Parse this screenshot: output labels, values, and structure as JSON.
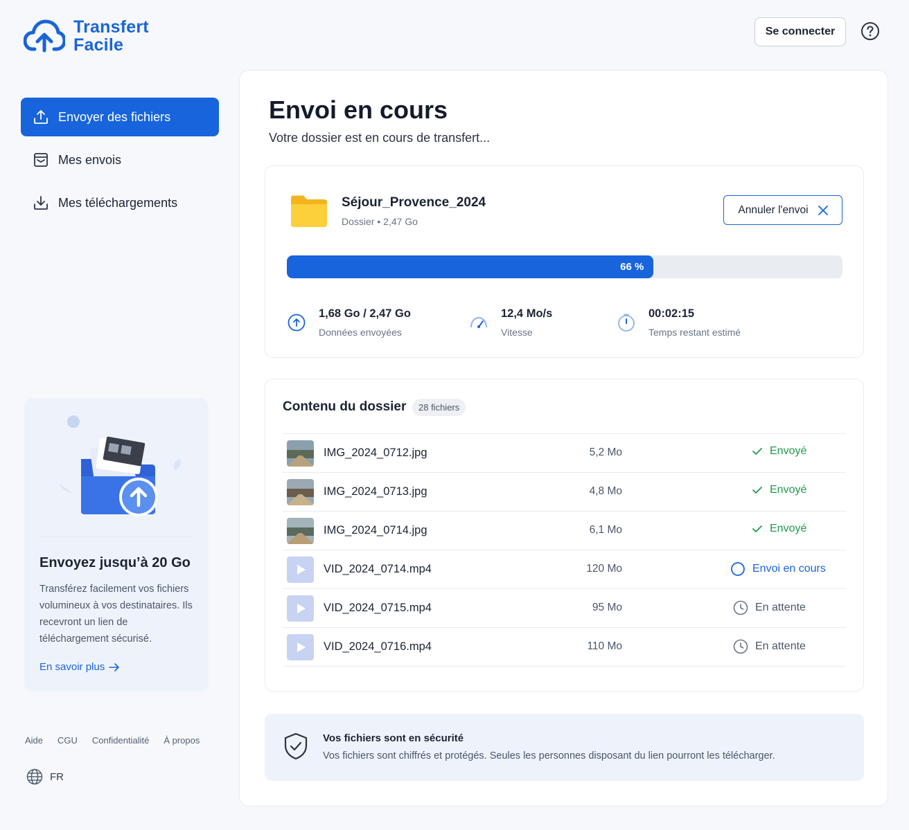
{
  "header": {
    "logo_line1": "Transfert",
    "logo_line2": "Facile",
    "login_label": "Se connecter"
  },
  "sidebar": {
    "items": [
      {
        "label": "Envoyer des fichiers",
        "icon": "upload-icon",
        "active": true
      },
      {
        "label": "Mes envois",
        "icon": "inbox-icon",
        "active": false
      },
      {
        "label": "Mes téléchargements",
        "icon": "download-icon",
        "active": false
      }
    ],
    "promo": {
      "title": "Envoyez jusqu’à 20 Go",
      "text": "Transférez facilement vos fichiers volumineux à vos destinataires. Ils recevront un lien de téléchargement sécurisé.",
      "link": "En savoir plus"
    },
    "footer_links": [
      "Aide",
      "CGU",
      "Confidentialité",
      "À propos"
    ],
    "language": "FR"
  },
  "main": {
    "title": "Envoi en cours",
    "subtitle": "Votre dossier est en cours de transfert...",
    "upload": {
      "folder_name": "Séjour_Provence_2024",
      "folder_type": "Dossier",
      "folder_size": "2,47 Go",
      "cancel_label": "Annuler l'envoi",
      "progress_percent": 66,
      "progress_label": "66 %",
      "stats": [
        {
          "value": "1,68 Go / 2,47 Go",
          "label": "Données envoyées",
          "icon": "upload-circle-icon"
        },
        {
          "value": "12,4 Mo/s",
          "label": "Vitesse",
          "icon": "speedometer-icon"
        },
        {
          "value": "00:02:15",
          "label": "Temps restant estimé",
          "icon": "stopwatch-icon"
        }
      ]
    },
    "contents": {
      "title": "Contenu du dossier",
      "count": "28 fichiers",
      "files": [
        {
          "name": "IMG_2024_0712.jpg",
          "size": "5,2 Mo",
          "status": "Envoyé",
          "kind": "image",
          "state": "done"
        },
        {
          "name": "IMG_2024_0713.jpg",
          "size": "4,8 Mo",
          "status": "Envoyé",
          "kind": "image",
          "state": "done"
        },
        {
          "name": "IMG_2024_0714.jpg",
          "size": "6,1 Mo",
          "status": "Envoyé",
          "kind": "image",
          "state": "done"
        },
        {
          "name": "VID_2024_0714.mp4",
          "size": "120 Mo",
          "status": "Envoi en cours",
          "kind": "video",
          "state": "progress"
        },
        {
          "name": "VID_2024_0715.mp4",
          "size": "95 Mo",
          "status": "En attente",
          "kind": "video",
          "state": "wait"
        },
        {
          "name": "VID_2024_0716.mp4",
          "size": "110 Mo",
          "status": "En attente",
          "kind": "video",
          "state": "wait"
        }
      ]
    },
    "security": {
      "title": "Vos fichiers sont en sécurité",
      "text": "Vos fichiers sont chiffrés et protégés. Seules les personnes disposant du lien pourront les télécharger."
    }
  },
  "colors": {
    "accent": "#1764dc",
    "success": "#1f9a4b",
    "folder": "#f8c52c"
  }
}
